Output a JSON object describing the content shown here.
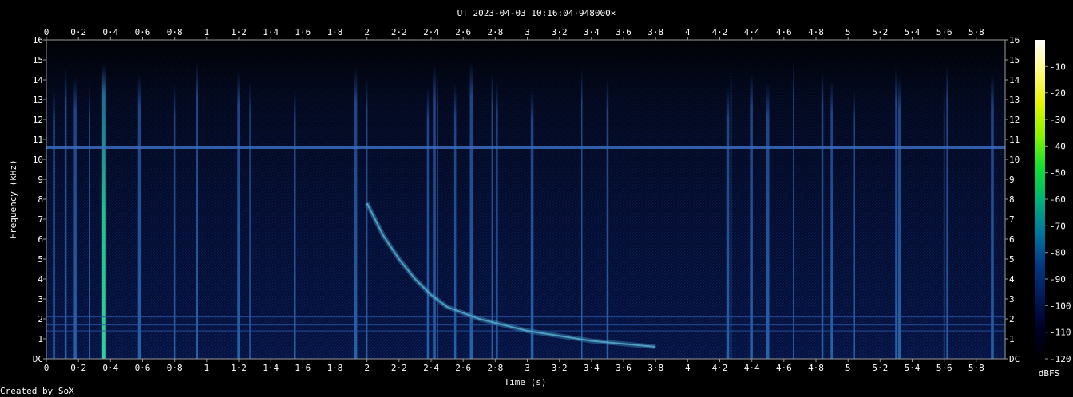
{
  "title": "UT 2023-04-03 10:16:04·948000×",
  "credit": "Created by SoX",
  "chart_data": {
    "type": "heatmap",
    "title": "UT 2023-04-03 10:16:04·948000×",
    "xlabel": "Time (s)",
    "ylabel": "Frequency (kHz)",
    "xlim": [
      0,
      5.98
    ],
    "ylim": [
      0,
      16
    ],
    "x_ticks": [
      "0",
      "0·2",
      "0·4",
      "0·6",
      "0·8",
      "1",
      "1·2",
      "1·4",
      "1·6",
      "1·8",
      "2",
      "2·2",
      "2·4",
      "2·6",
      "2·8",
      "3",
      "3·2",
      "3·4",
      "3·6",
      "3·8",
      "4",
      "4·2",
      "4·4",
      "4·6",
      "4·8",
      "5",
      "5·2",
      "5·4",
      "5·6",
      "5·8"
    ],
    "x_tick_values": [
      0,
      0.2,
      0.4,
      0.6,
      0.8,
      1,
      1.2,
      1.4,
      1.6,
      1.8,
      2,
      2.2,
      2.4,
      2.6,
      2.8,
      3,
      3.2,
      3.4,
      3.6,
      3.8,
      4,
      4.2,
      4.4,
      4.6,
      4.8,
      5,
      5.2,
      5.4,
      5.6,
      5.8
    ],
    "y_ticks": [
      "DC",
      "1",
      "2",
      "3",
      "4",
      "5",
      "6",
      "7",
      "8",
      "9",
      "10",
      "11",
      "12",
      "13",
      "14",
      "15",
      "16"
    ],
    "y_tick_values": [
      0,
      1,
      2,
      3,
      4,
      5,
      6,
      7,
      8,
      9,
      10,
      11,
      12,
      13,
      14,
      15,
      16
    ],
    "colorbar": {
      "label": "dBFS",
      "ticks": [
        "-10",
        "-20",
        "-30",
        "-40",
        "-50",
        "-60",
        "-70",
        "-80",
        "-90",
        "-100",
        "-110",
        "-120"
      ],
      "tick_values": [
        -10,
        -20,
        -30,
        -40,
        -50,
        -60,
        -70,
        -80,
        -90,
        -100,
        -110,
        -120
      ],
      "range": [
        -120,
        0
      ]
    },
    "features": {
      "tone_line_khz": 10.6,
      "low_lines_khz": [
        2.1,
        1.4,
        1.7
      ],
      "whistler_points": [
        [
          2.0,
          7.8
        ],
        [
          2.1,
          6.2
        ],
        [
          2.2,
          5.0
        ],
        [
          2.3,
          4.0
        ],
        [
          2.4,
          3.2
        ],
        [
          2.5,
          2.6
        ],
        [
          2.7,
          2.0
        ],
        [
          3.0,
          1.4
        ],
        [
          3.4,
          0.9
        ],
        [
          3.8,
          0.6
        ]
      ],
      "sferics_s": [
        0.05,
        0.12,
        0.18,
        0.27,
        0.36,
        0.58,
        0.8,
        0.94,
        1.2,
        1.27,
        1.55,
        1.93,
        2.0,
        2.38,
        2.42,
        2.44,
        2.55,
        2.65,
        2.78,
        2.81,
        3.03,
        3.34,
        3.5,
        4.25,
        4.27,
        4.4,
        4.5,
        4.66,
        4.84,
        4.9,
        5.04,
        5.3,
        5.32,
        5.6,
        5.62,
        5.9
      ],
      "strong_sferic_s": 0.36
    },
    "legend": "right"
  }
}
